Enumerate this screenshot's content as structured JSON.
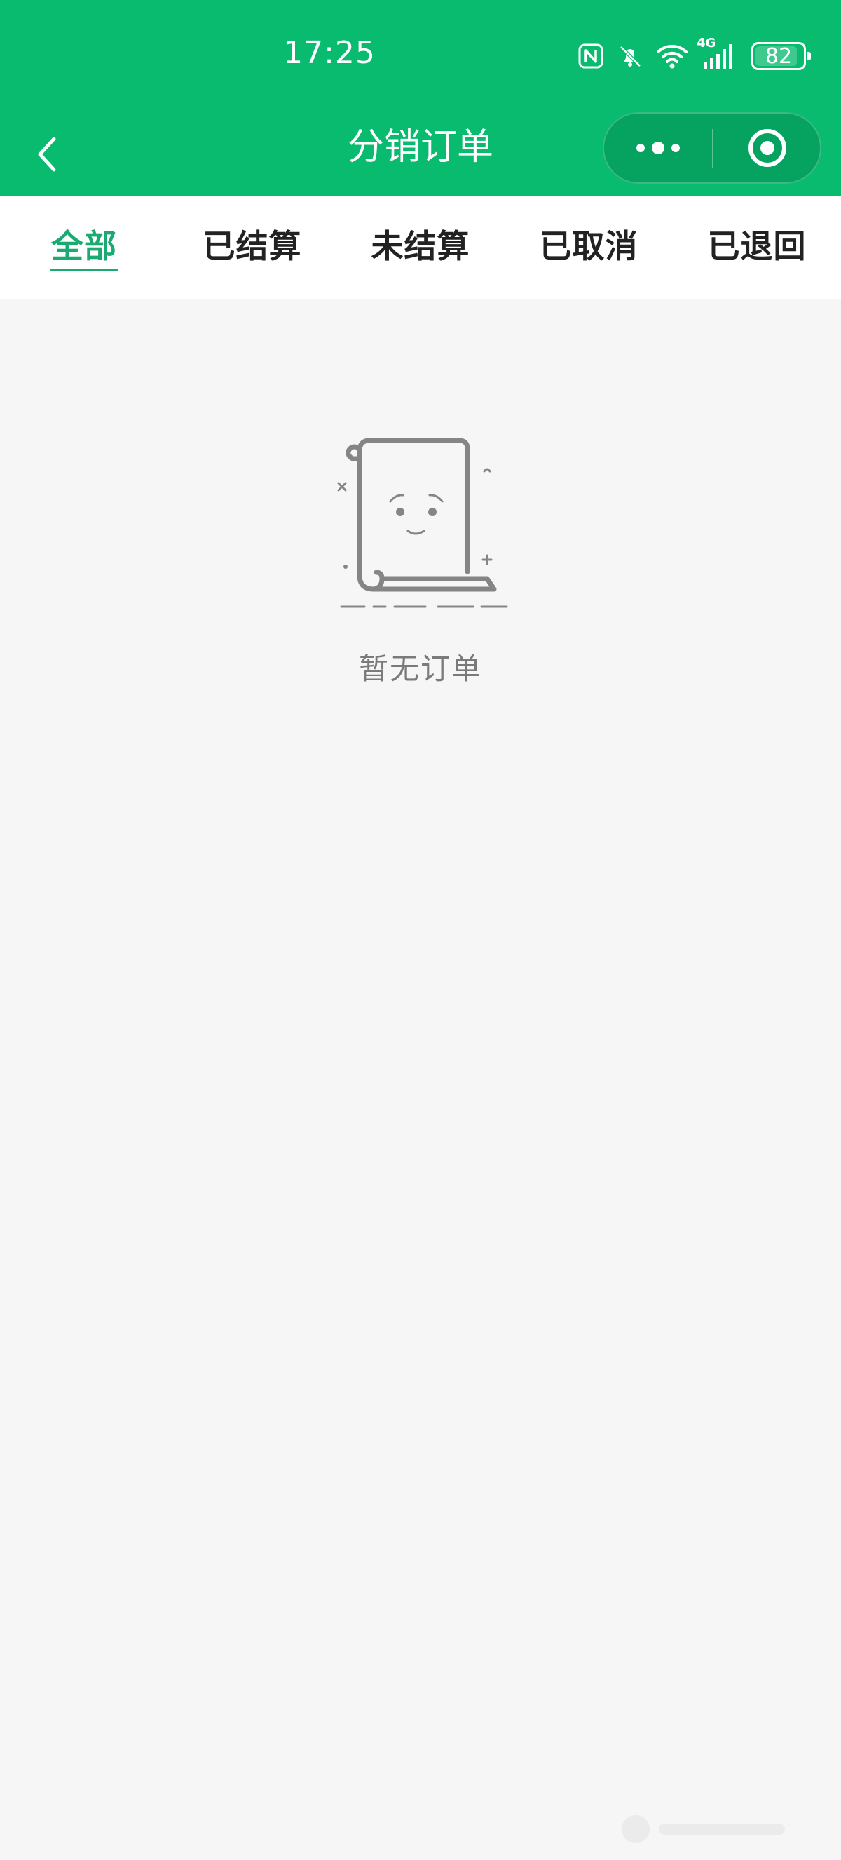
{
  "status_bar": {
    "time": "17:25",
    "network": "4G",
    "battery_level": "82",
    "icons": [
      "nfc-icon",
      "bell-muted-icon",
      "wifi-icon",
      "signal-icon",
      "battery-icon"
    ]
  },
  "nav": {
    "title": "分销订单",
    "back_icon": "chevron-left-icon",
    "more_icon": "more-dots-icon",
    "close_icon": "target-close-icon"
  },
  "tabs": [
    {
      "label": "全部",
      "active": true
    },
    {
      "label": "已结算",
      "active": false
    },
    {
      "label": "未结算",
      "active": false
    },
    {
      "label": "已取消",
      "active": false
    },
    {
      "label": "已退回",
      "active": false
    }
  ],
  "empty_state": {
    "message": "暂无订单",
    "illustration": "empty-scroll-icon"
  },
  "colors": {
    "brand": "#08bb6f",
    "accent": "#1aaa72",
    "background": "#f6f6f6",
    "tab_text": "#222222",
    "empty_text": "#7a7a7a"
  }
}
